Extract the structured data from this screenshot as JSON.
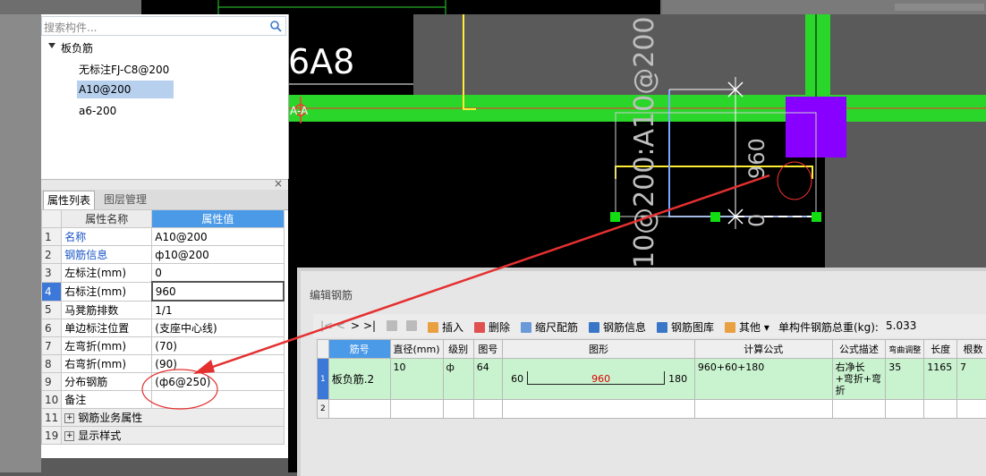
{
  "cad": {
    "label_top_left": "6A8",
    "label_aa": "A-A",
    "label_vertical": "10@200:A10@200",
    "dim_960": "960",
    "dim_0": "0"
  },
  "tree": {
    "search_placeholder": "搜索构件...",
    "root": "板负筋",
    "items": [
      "无标注FJ-C8@200",
      "A10@200",
      "a6-200"
    ],
    "selected_index": 1
  },
  "props": {
    "tabs": [
      "属性列表",
      "图层管理"
    ],
    "header_name": "属性名称",
    "header_value": "属性值",
    "rows": [
      {
        "num": "1",
        "name": "名称",
        "value": "A10@200"
      },
      {
        "num": "2",
        "name": "钢筋信息",
        "value": "ф10@200"
      },
      {
        "num": "3",
        "name": "左标注(mm)",
        "value": "0"
      },
      {
        "num": "4",
        "name": "右标注(mm)",
        "value": "960"
      },
      {
        "num": "5",
        "name": "马凳筋排数",
        "value": "1/1"
      },
      {
        "num": "6",
        "name": "单边标注位置",
        "value": "(支座中心线)"
      },
      {
        "num": "7",
        "name": "左弯折(mm)",
        "value": "(70)"
      },
      {
        "num": "8",
        "name": "右弯折(mm)",
        "value": "(90)"
      },
      {
        "num": "9",
        "name": "分布钢筋",
        "value": "(ф6@250)"
      },
      {
        "num": "10",
        "name": "备注",
        "value": ""
      },
      {
        "num": "11",
        "name": "钢筋业务属性",
        "value": ""
      },
      {
        "num": "19",
        "name": "显示样式",
        "value": ""
      }
    ]
  },
  "editor": {
    "title": "编辑钢筋",
    "toolbar": {
      "nav": [
        "|<",
        "<",
        ">",
        ">|"
      ],
      "insert": "插入",
      "delete": "删除",
      "scale": "缩尺配筋",
      "info": "钢筋信息",
      "library": "钢筋图库",
      "other": "其他",
      "weight_label": "单构件钢筋总重(kg):",
      "weight_value": "5.033"
    },
    "columns": [
      "筋号",
      "直径(mm)",
      "级别",
      "图号",
      "图形",
      "计算公式",
      "公式描述",
      "弯曲调整",
      "长度",
      "根数"
    ],
    "rows": [
      {
        "num": "1",
        "name": "板负筋.2",
        "diameter": "10",
        "grade": "ф",
        "fig": "64",
        "shape_left": "60",
        "shape_mid": "960",
        "shape_right": "180",
        "formula": "960+60+180",
        "desc": "右净长+弯折+弯折",
        "bend": "35",
        "length": "1165",
        "count": "7"
      },
      {
        "num": "2"
      }
    ]
  }
}
